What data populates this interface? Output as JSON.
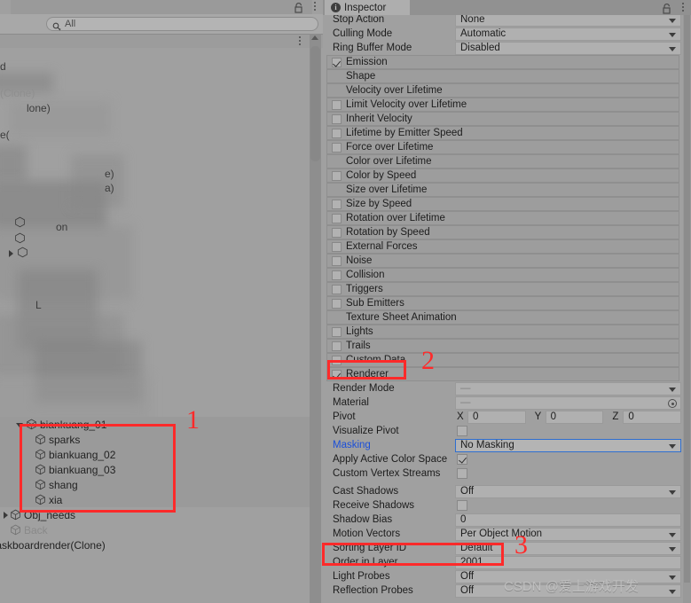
{
  "window": {
    "left_panel_name": "Hierarchy",
    "right_panel_name": "Inspector"
  },
  "hierarchy": {
    "search": {
      "placeholder": "All",
      "value": "",
      "icon": "search-icon"
    },
    "lock_icon": "lock-icon",
    "menu_icon": "kebab-menu-icon",
    "obscured_fragments": [
      "d",
      "(Clone)",
      "lone)",
      "e(",
      "e)",
      "a)",
      "on",
      "L"
    ],
    "items": [
      {
        "label": "biankuang_01",
        "indent": 1,
        "expandable": true,
        "expanded": true,
        "dim": false,
        "selected": false
      },
      {
        "label": "sparks",
        "indent": 2,
        "expandable": false,
        "expanded": false,
        "dim": false,
        "selected": false
      },
      {
        "label": "biankuang_02",
        "indent": 2,
        "expandable": false,
        "expanded": false,
        "dim": false,
        "selected": false
      },
      {
        "label": "biankuang_03",
        "indent": 2,
        "expandable": false,
        "expanded": false,
        "dim": false,
        "selected": false
      },
      {
        "label": "shang",
        "indent": 2,
        "expandable": false,
        "expanded": false,
        "dim": false,
        "selected": false
      },
      {
        "label": "xia",
        "indent": 2,
        "expandable": false,
        "expanded": false,
        "dim": false,
        "selected": false
      },
      {
        "label": "Obj_needs",
        "indent": 0,
        "expandable": true,
        "expanded": false,
        "dim": false,
        "selected": false
      },
      {
        "label": "Back",
        "indent": 0,
        "expandable": false,
        "expanded": false,
        "dim": true,
        "selected": false
      },
      {
        "label": "taskboardrender(Clone)",
        "indent": 0,
        "expandable": false,
        "expanded": false,
        "dim": false,
        "selected": false
      }
    ]
  },
  "inspector": {
    "tab_label": "Inspector",
    "tab_icon": "info-icon",
    "lock_icon": "lock-icon",
    "menu_icon": "kebab-menu-icon",
    "top_properties": [
      {
        "label": "Stop Action",
        "value": "None",
        "type": "dropdown"
      },
      {
        "label": "Culling Mode",
        "value": "Automatic",
        "type": "dropdown"
      },
      {
        "label": "Ring Buffer Mode",
        "value": "Disabled",
        "type": "dropdown"
      }
    ],
    "modules": [
      {
        "label": "Emission",
        "checkbox": "checked"
      },
      {
        "label": "Shape",
        "checkbox": "none"
      },
      {
        "label": "Velocity over Lifetime",
        "checkbox": "none"
      },
      {
        "label": "Limit Velocity over Lifetime",
        "checkbox": "unchecked"
      },
      {
        "label": "Inherit Velocity",
        "checkbox": "unchecked"
      },
      {
        "label": "Lifetime by Emitter Speed",
        "checkbox": "unchecked"
      },
      {
        "label": "Force over Lifetime",
        "checkbox": "unchecked"
      },
      {
        "label": "Color over Lifetime",
        "checkbox": "none"
      },
      {
        "label": "Color by Speed",
        "checkbox": "unchecked"
      },
      {
        "label": "Size over Lifetime",
        "checkbox": "none"
      },
      {
        "label": "Size by Speed",
        "checkbox": "unchecked"
      },
      {
        "label": "Rotation over Lifetime",
        "checkbox": "unchecked"
      },
      {
        "label": "Rotation by Speed",
        "checkbox": "unchecked"
      },
      {
        "label": "External Forces",
        "checkbox": "unchecked"
      },
      {
        "label": "Noise",
        "checkbox": "unchecked"
      },
      {
        "label": "Collision",
        "checkbox": "unchecked"
      },
      {
        "label": "Triggers",
        "checkbox": "unchecked"
      },
      {
        "label": "Sub Emitters",
        "checkbox": "unchecked"
      },
      {
        "label": "Texture Sheet Animation",
        "checkbox": "none"
      },
      {
        "label": "Lights",
        "checkbox": "unchecked"
      },
      {
        "label": "Trails",
        "checkbox": "unchecked"
      },
      {
        "label": "Custom Data",
        "checkbox": "unchecked"
      },
      {
        "label": "Renderer",
        "checkbox": "checked"
      }
    ],
    "renderer_properties": [
      {
        "label": "Render Mode",
        "value": "—",
        "type": "dropdown",
        "muted": true
      },
      {
        "label": "Material",
        "value": "—",
        "type": "object",
        "muted": true
      },
      {
        "label": "Pivot",
        "type": "vector3",
        "axes": [
          "X",
          "Y",
          "Z"
        ],
        "values": [
          "0",
          "0",
          "0"
        ]
      },
      {
        "label": "Visualize Pivot",
        "type": "checkbox",
        "checked": false
      },
      {
        "label": "Masking",
        "value": "No Masking",
        "type": "dropdown",
        "highlight": true
      },
      {
        "label": "Apply Active Color Space",
        "type": "checkbox",
        "checked": true
      },
      {
        "label": "Custom Vertex Streams",
        "type": "checkbox",
        "checked": false
      },
      {
        "label": "Cast Shadows",
        "value": "Off",
        "type": "dropdown"
      },
      {
        "label": "Receive Shadows",
        "type": "checkbox",
        "checked": false
      },
      {
        "label": "Shadow Bias",
        "value": "0",
        "type": "text"
      },
      {
        "label": "Motion Vectors",
        "value": "Per Object Motion",
        "type": "dropdown"
      },
      {
        "label": "Sorting Layer ID",
        "value": "Default",
        "type": "dropdown"
      },
      {
        "label": "Order in Layer",
        "value": "2001",
        "type": "text"
      },
      {
        "label": "Light Probes",
        "value": "Off",
        "type": "dropdown"
      },
      {
        "label": "Reflection Probes",
        "value": "Off",
        "type": "dropdown"
      }
    ]
  },
  "annotations": {
    "color": "#ff2a2a",
    "markers": [
      {
        "number": "1",
        "target": "hierarchy-children-group"
      },
      {
        "number": "2",
        "target": "renderer-module-row"
      },
      {
        "number": "3",
        "target": "order-in-layer-row"
      }
    ]
  },
  "watermark": {
    "text": "CSDN @爱上游戏开发"
  }
}
